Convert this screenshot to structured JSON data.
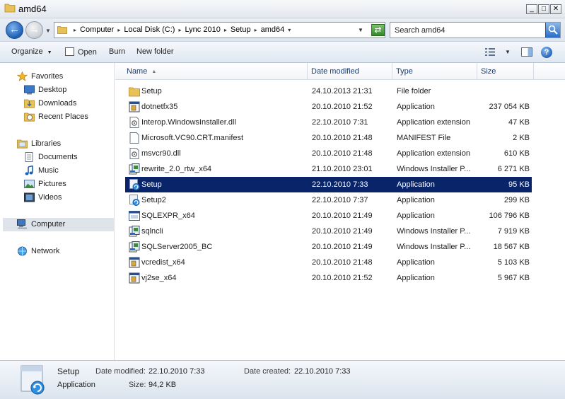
{
  "window": {
    "title": "amd64"
  },
  "address": {
    "crumbs": [
      "Computer",
      "Local Disk (C:)",
      "Lync 2010",
      "Setup",
      "amd64"
    ]
  },
  "search": {
    "placeholder": "Search amd64"
  },
  "toolbar": {
    "organize": "Organize",
    "open": "Open",
    "burn": "Burn",
    "new_folder": "New folder"
  },
  "nav": {
    "favorites": "Favorites",
    "desktop": "Desktop",
    "downloads": "Downloads",
    "recent": "Recent Places",
    "libraries": "Libraries",
    "documents": "Documents",
    "music": "Music",
    "pictures": "Pictures",
    "videos": "Videos",
    "computer": "Computer",
    "network": "Network"
  },
  "columns": {
    "name": "Name",
    "date": "Date modified",
    "type": "Type",
    "size": "Size"
  },
  "files": [
    {
      "name": "Setup",
      "date": "24.10.2013 21:31",
      "type": "File folder",
      "size": "",
      "icon": "folder-icon"
    },
    {
      "name": "dotnetfx35",
      "date": "20.10.2010 21:52",
      "type": "Application",
      "size": "237 054 KB",
      "icon": "app-icon"
    },
    {
      "name": "Interop.WindowsInstaller.dll",
      "date": "22.10.2010 7:31",
      "type": "Application extension",
      "size": "47 KB",
      "icon": "dll-icon"
    },
    {
      "name": "Microsoft.VC90.CRT.manifest",
      "date": "20.10.2010 21:48",
      "type": "MANIFEST File",
      "size": "2 KB",
      "icon": "file-icon"
    },
    {
      "name": "msvcr90.dll",
      "date": "20.10.2010 21:48",
      "type": "Application extension",
      "size": "610 KB",
      "icon": "dll-icon"
    },
    {
      "name": "rewrite_2.0_rtw_x64",
      "date": "21.10.2010 23:01",
      "type": "Windows Installer P...",
      "size": "6 271 KB",
      "icon": "msi-icon"
    },
    {
      "name": "Setup",
      "date": "22.10.2010 7:33",
      "type": "Application",
      "size": "95 KB",
      "icon": "setup-icon"
    },
    {
      "name": "Setup2",
      "date": "22.10.2010 7:37",
      "type": "Application",
      "size": "299 KB",
      "icon": "setup-icon"
    },
    {
      "name": "SQLEXPR_x64",
      "date": "20.10.2010 21:49",
      "type": "Application",
      "size": "106 796 KB",
      "icon": "window-app-icon"
    },
    {
      "name": "sqlncli",
      "date": "20.10.2010 21:49",
      "type": "Windows Installer P...",
      "size": "7 919 KB",
      "icon": "msi-icon"
    },
    {
      "name": "SQLServer2005_BC",
      "date": "20.10.2010 21:49",
      "type": "Windows Installer P...",
      "size": "18 567 KB",
      "icon": "msi-icon"
    },
    {
      "name": "vcredist_x64",
      "date": "20.10.2010 21:48",
      "type": "Application",
      "size": "5 103 KB",
      "icon": "app-icon"
    },
    {
      "name": "vj2se_x64",
      "date": "20.10.2010 21:52",
      "type": "Application",
      "size": "5 967 KB",
      "icon": "app-icon"
    }
  ],
  "selected_index": 6,
  "details": {
    "name": "Setup",
    "type": "Application",
    "date_modified_label": "Date modified:",
    "date_modified": "22.10.2010 7:33",
    "date_created_label": "Date created:",
    "date_created": "22.10.2010 7:33",
    "size_label": "Size:",
    "size": "94,2 KB"
  },
  "colors": {
    "selection": "#0a246a",
    "header_text": "#1e3a6a",
    "accent": "#1d5fb5"
  }
}
